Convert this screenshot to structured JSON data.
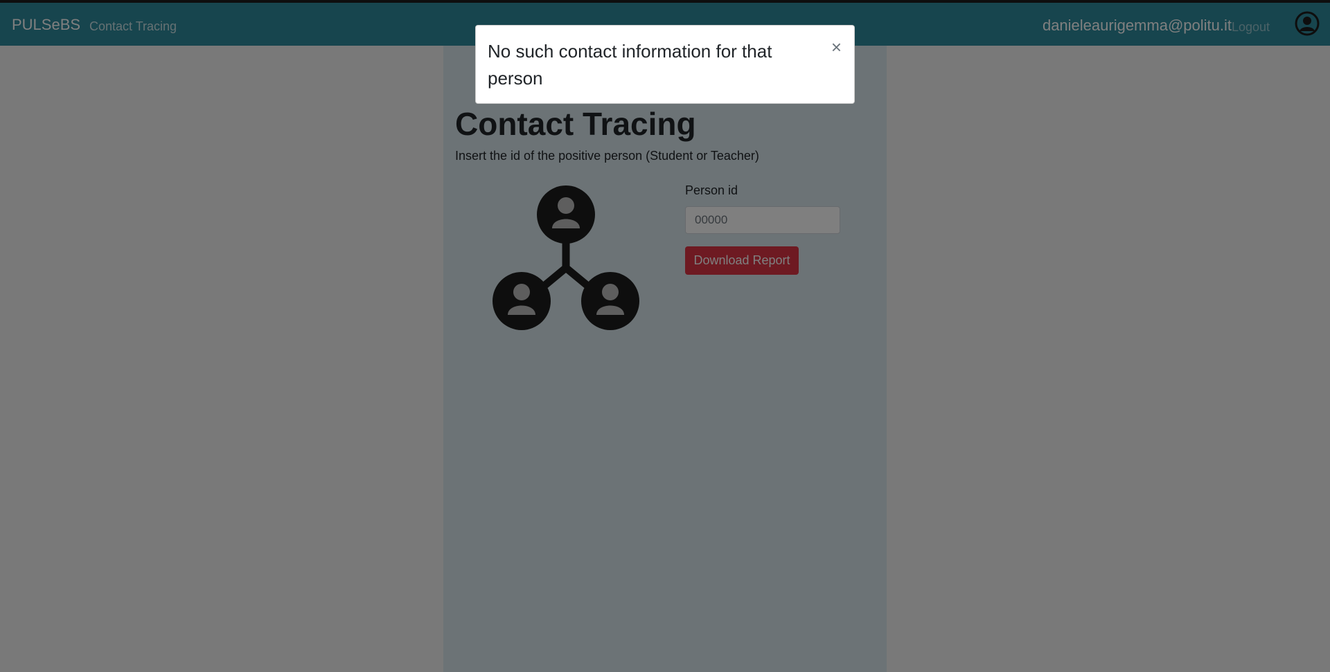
{
  "navbar": {
    "brand": "PULSeBS",
    "nav_link": "Contact Tracing",
    "user_email": "danieleaurigemma@politu.it",
    "logout_label": "Logout",
    "user_icon": "user-circle-icon"
  },
  "main": {
    "title": "Contact Tracing",
    "subtitle": "Insert the id of the positive person (Student or Teacher)",
    "illustration_icon": "contact-network-icon",
    "person_id_label": "Person id",
    "person_id_placeholder": "00000",
    "download_button_label": "Download Report"
  },
  "modal": {
    "message": "No such contact information for that person",
    "close_glyph": "×"
  },
  "colors": {
    "navbar": "#2f8a9c",
    "danger": "#dc3545",
    "content_bg": "#d9e7ec"
  }
}
